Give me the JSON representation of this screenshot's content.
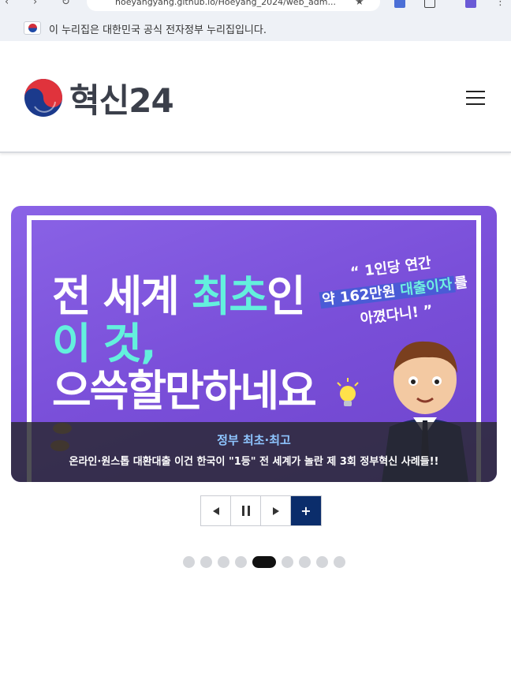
{
  "browser": {
    "url": "hoeyangyang.github.io/Hoeyang_2024/web_adm..."
  },
  "gov_banner": {
    "text": "이 누리집은 대한민국 공식 전자정부 누리집입니다."
  },
  "header": {
    "logo_text": "혁신24",
    "menu_icon": "hamburger-icon"
  },
  "slide": {
    "headline_line1_a": "전 세계 ",
    "headline_line1_b": "최초",
    "headline_line1_c": "인",
    "headline_line2": "이 것,",
    "headline_line3": "으쓱할만하네요",
    "quote_line1": "“ 1인당 연간",
    "quote_line2_a": "약 162만원 ",
    "quote_line2_b": "대출이자",
    "quote_line2_c": "를",
    "quote_line3": "아꼈다니! ”",
    "category": "정부 최초·최고",
    "title": "온라인·원스톱 대환대출 이건 한국이 \"1등\" 전 세계가 놀란 제 3회 정부혁신 사례들!!"
  },
  "controls": {
    "prev_icon": "triangle-left-icon",
    "pause_icon": "pause-icon",
    "next_icon": "triangle-right-icon",
    "more_label": "+"
  },
  "pagination": {
    "total": 9,
    "active_index": 4
  },
  "colors": {
    "brand_navy": "#0b2d6b",
    "slide_purple": "#7a4fd9",
    "accent_mint": "#63f0dd",
    "category_blue": "#8ec5ff"
  }
}
